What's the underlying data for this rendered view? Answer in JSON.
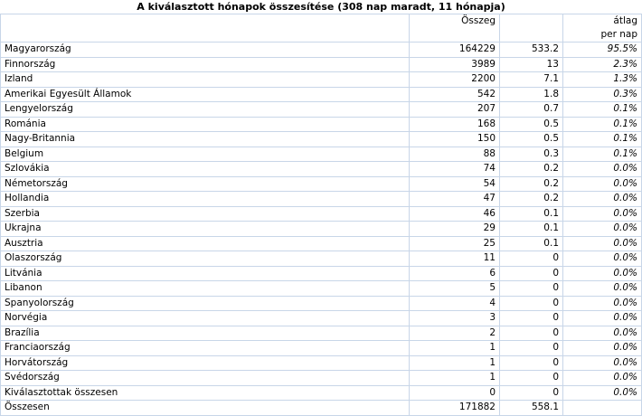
{
  "title": "A kiválasztott hónapok összesítése (308 nap maradt, 11 hónapja)",
  "headers": {
    "country": "",
    "total": "Összeg",
    "avg": "",
    "pct_line1": "átlag",
    "pct_line2": "per nap"
  },
  "rows": [
    {
      "country": "Magyarország",
      "total": "164229",
      "avg": "533.2",
      "pct": "95.5%"
    },
    {
      "country": "Finnország",
      "total": "3989",
      "avg": "13",
      "pct": "2.3%"
    },
    {
      "country": "Izland",
      "total": "2200",
      "avg": "7.1",
      "pct": "1.3%"
    },
    {
      "country": "Amerikai Egyesült Államok",
      "total": "542",
      "avg": "1.8",
      "pct": "0.3%"
    },
    {
      "country": "Lengyelország",
      "total": "207",
      "avg": "0.7",
      "pct": "0.1%"
    },
    {
      "country": "Románia",
      "total": "168",
      "avg": "0.5",
      "pct": "0.1%"
    },
    {
      "country": "Nagy-Britannia",
      "total": "150",
      "avg": "0.5",
      "pct": "0.1%"
    },
    {
      "country": "Belgium",
      "total": "88",
      "avg": "0.3",
      "pct": "0.1%"
    },
    {
      "country": "Szlovákia",
      "total": "74",
      "avg": "0.2",
      "pct": "0.0%"
    },
    {
      "country": "Németország",
      "total": "54",
      "avg": "0.2",
      "pct": "0.0%"
    },
    {
      "country": "Hollandia",
      "total": "47",
      "avg": "0.2",
      "pct": "0.0%"
    },
    {
      "country": "Szerbia",
      "total": "46",
      "avg": "0.1",
      "pct": "0.0%"
    },
    {
      "country": "Ukrajna",
      "total": "29",
      "avg": "0.1",
      "pct": "0.0%"
    },
    {
      "country": "Ausztria",
      "total": "25",
      "avg": "0.1",
      "pct": "0.0%"
    },
    {
      "country": "Olaszország",
      "total": "11",
      "avg": "0",
      "pct": "0.0%"
    },
    {
      "country": "Litvánia",
      "total": "6",
      "avg": "0",
      "pct": "0.0%"
    },
    {
      "country": "Libanon",
      "total": "5",
      "avg": "0",
      "pct": "0.0%"
    },
    {
      "country": "Spanyolország",
      "total": "4",
      "avg": "0",
      "pct": "0.0%"
    },
    {
      "country": "Norvégia",
      "total": "3",
      "avg": "0",
      "pct": "0.0%"
    },
    {
      "country": "Brazília",
      "total": "2",
      "avg": "0",
      "pct": "0.0%"
    },
    {
      "country": "Franciaország",
      "total": "1",
      "avg": "0",
      "pct": "0.0%"
    },
    {
      "country": "Horvátország",
      "total": "1",
      "avg": "0",
      "pct": "0.0%"
    },
    {
      "country": "Svédország",
      "total": "1",
      "avg": "0",
      "pct": "0.0%"
    },
    {
      "country": "Kiválasztottak összesen",
      "total": "0",
      "avg": "0",
      "pct": "0.0%"
    }
  ],
  "footer": {
    "country": "Összesen",
    "total": "171882",
    "avg": "558.1",
    "pct": ""
  }
}
